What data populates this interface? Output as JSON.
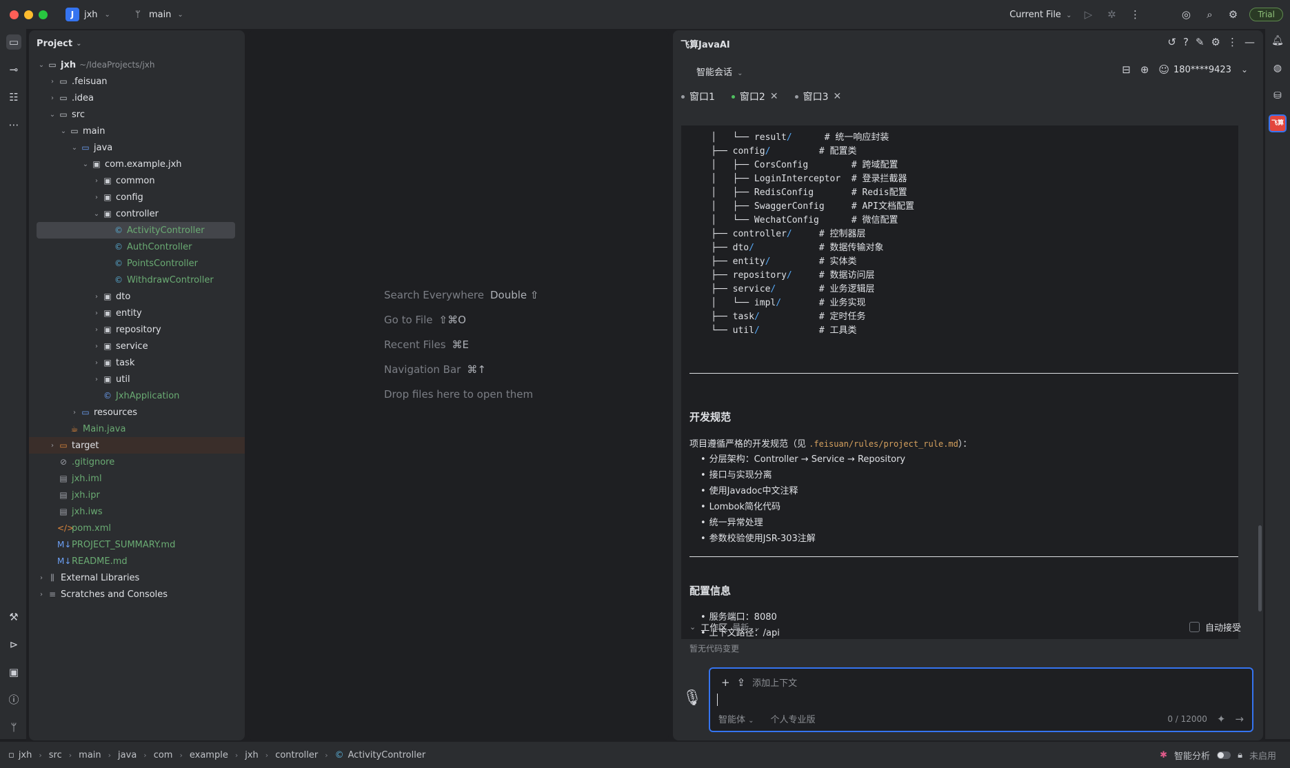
{
  "titlebar": {
    "project_badge": "J",
    "project_name": "jxh",
    "branch": "main",
    "run_config": "Current File",
    "trial": "Trial"
  },
  "project_panel": {
    "title": "Project",
    "tree": [
      {
        "label": "jxh",
        "extra": "~/IdeaProjects/jxh",
        "arrow": "v",
        "icon": "folder",
        "indent": 0,
        "bold": true
      },
      {
        "label": ".feisuan",
        "arrow": ">",
        "icon": "folder",
        "indent": 1
      },
      {
        "label": ".idea",
        "arrow": ">",
        "icon": "folder",
        "indent": 1
      },
      {
        "label": "src",
        "arrow": "v",
        "icon": "folder",
        "indent": 1
      },
      {
        "label": "main",
        "arrow": "v",
        "icon": "folder",
        "indent": 2
      },
      {
        "label": "java",
        "arrow": "v",
        "icon": "folder-blue",
        "indent": 3
      },
      {
        "label": "com.example.jxh",
        "arrow": "v",
        "icon": "package",
        "indent": 4
      },
      {
        "label": "common",
        "arrow": ">",
        "icon": "package",
        "indent": 5
      },
      {
        "label": "config",
        "arrow": ">",
        "icon": "package",
        "indent": 5
      },
      {
        "label": "controller",
        "arrow": "v",
        "icon": "package",
        "indent": 5
      },
      {
        "label": "ActivityController",
        "arrow": "",
        "icon": "class",
        "indent": 6,
        "color": "green",
        "selected": true
      },
      {
        "label": "AuthController",
        "arrow": "",
        "icon": "class",
        "indent": 6,
        "color": "green"
      },
      {
        "label": "PointsController",
        "arrow": "",
        "icon": "class",
        "indent": 6,
        "color": "green"
      },
      {
        "label": "WithdrawController",
        "arrow": "",
        "icon": "class",
        "indent": 6,
        "color": "green"
      },
      {
        "label": "dto",
        "arrow": ">",
        "icon": "package",
        "indent": 5
      },
      {
        "label": "entity",
        "arrow": ">",
        "icon": "package",
        "indent": 5
      },
      {
        "label": "repository",
        "arrow": ">",
        "icon": "package",
        "indent": 5
      },
      {
        "label": "service",
        "arrow": ">",
        "icon": "package",
        "indent": 5
      },
      {
        "label": "task",
        "arrow": ">",
        "icon": "package",
        "indent": 5
      },
      {
        "label": "util",
        "arrow": ">",
        "icon": "package",
        "indent": 5
      },
      {
        "label": "JxhApplication",
        "arrow": "",
        "icon": "class-app",
        "indent": 5,
        "color": "green"
      },
      {
        "label": "resources",
        "arrow": ">",
        "icon": "folder-blue",
        "indent": 3
      },
      {
        "label": "Main.java",
        "arrow": "",
        "icon": "java-file",
        "indent": 2,
        "color": "green"
      },
      {
        "label": "target",
        "arrow": ">",
        "icon": "folder-orange",
        "indent": 1,
        "excluded": true
      },
      {
        "label": ".gitignore",
        "arrow": "",
        "icon": "ignore",
        "indent": 1,
        "color": "green"
      },
      {
        "label": "jxh.iml",
        "arrow": "",
        "icon": "file",
        "indent": 1,
        "color": "green"
      },
      {
        "label": "jxh.ipr",
        "arrow": "",
        "icon": "file",
        "indent": 1,
        "color": "green"
      },
      {
        "label": "jxh.iws",
        "arrow": "",
        "icon": "file",
        "indent": 1,
        "color": "green"
      },
      {
        "label": "pom.xml",
        "arrow": "",
        "icon": "xml",
        "indent": 1,
        "color": "green"
      },
      {
        "label": "PROJECT_SUMMARY.md",
        "arrow": "",
        "icon": "md",
        "indent": 1,
        "color": "green"
      },
      {
        "label": "README.md",
        "arrow": "",
        "icon": "md",
        "indent": 1,
        "color": "green"
      },
      {
        "label": "External Libraries",
        "arrow": ">",
        "icon": "library",
        "indent": 0
      },
      {
        "label": "Scratches and Consoles",
        "arrow": ">",
        "icon": "scratch",
        "indent": 0
      }
    ]
  },
  "editor_hints": [
    {
      "label": "Search Everywhere",
      "key": "Double ⇧"
    },
    {
      "label": "Go to File",
      "key": "⇧⌘O"
    },
    {
      "label": "Recent Files",
      "key": "⌘E"
    },
    {
      "label": "Navigation Bar",
      "key": "⌘↑"
    },
    {
      "label": "Drop files here to open them",
      "key": ""
    }
  ],
  "ai_panel": {
    "title": "飞算JavaAI",
    "mode": "智能会话",
    "user": "180****9423",
    "tabs": [
      {
        "label": "窗口1",
        "active": false,
        "closable": false
      },
      {
        "label": "窗口2",
        "active": true,
        "closable": true
      },
      {
        "label": "窗口3",
        "active": false,
        "closable": true
      }
    ],
    "code_lines": [
      {
        "prefix": "│   └── ",
        "name": "result",
        "slash": "/",
        "pad": "      ",
        "comment": "# 统一响应封装"
      },
      {
        "prefix": "├── ",
        "name": "config",
        "slash": "/",
        "pad": "         ",
        "comment": "# 配置类"
      },
      {
        "prefix": "│   ├── ",
        "name": "CorsConfig",
        "slash": "",
        "pad": "        ",
        "comment": "# 跨域配置"
      },
      {
        "prefix": "│   ├── ",
        "name": "LoginInterceptor",
        "slash": "",
        "pad": "  ",
        "comment": "# 登录拦截器"
      },
      {
        "prefix": "│   ├── ",
        "name": "RedisConfig",
        "slash": "",
        "pad": "       ",
        "comment": "# Redis配置"
      },
      {
        "prefix": "│   ├── ",
        "name": "SwaggerConfig",
        "slash": "",
        "pad": "     ",
        "comment": "# API文档配置"
      },
      {
        "prefix": "│   └── ",
        "name": "WechatConfig",
        "slash": "",
        "pad": "      ",
        "comment": "# 微信配置"
      },
      {
        "prefix": "├── ",
        "name": "controller",
        "slash": "/",
        "pad": "     ",
        "comment": "# 控制器层"
      },
      {
        "prefix": "├── ",
        "name": "dto",
        "slash": "/",
        "pad": "            ",
        "comment": "# 数据传输对象"
      },
      {
        "prefix": "├── ",
        "name": "entity",
        "slash": "/",
        "pad": "         ",
        "comment": "# 实体类"
      },
      {
        "prefix": "├── ",
        "name": "repository",
        "slash": "/",
        "pad": "     ",
        "comment": "# 数据访问层"
      },
      {
        "prefix": "├── ",
        "name": "service",
        "slash": "/",
        "pad": "        ",
        "comment": "# 业务逻辑层"
      },
      {
        "prefix": "│   └── ",
        "name": "impl",
        "slash": "/",
        "pad": "       ",
        "comment": "# 业务实现"
      },
      {
        "prefix": "├── ",
        "name": "task",
        "slash": "/",
        "pad": "           ",
        "comment": "# 定时任务"
      },
      {
        "prefix": "└── ",
        "name": "util",
        "slash": "/",
        "pad": "           ",
        "comment": "# 工具类"
      }
    ],
    "dev_heading": "开发规范",
    "dev_intro_prefix": "项目遵循严格的开发规范（见 ",
    "dev_intro_code": ".feisuan/rules/project_rule.md",
    "dev_intro_suffix": "）：",
    "dev_items": [
      "分层架构：Controller → Service → Repository",
      "接口与实现分离",
      "使用Javadoc中文注释",
      "Lombok简化代码",
      "统一异常处理",
      "参数校验使用JSR-303注解"
    ],
    "config_heading": "配置信息",
    "config_items": [
      "服务端口：8080",
      "上下文路径：/api"
    ],
    "workarea": "工作区",
    "workarea_sub": "最新",
    "auto_accept": "自动接受",
    "no_changes": "暂无代码变更",
    "add_context": "添加上下文",
    "agent": "智能体",
    "edition": "个人专业版",
    "counter": "0 / 12000"
  },
  "statusbar": {
    "breadcrumbs": [
      "jxh",
      "src",
      "main",
      "java",
      "com",
      "example",
      "jxh",
      "controller",
      "ActivityController"
    ],
    "smart_analysis": "智能分析",
    "disabled": "未启用"
  }
}
